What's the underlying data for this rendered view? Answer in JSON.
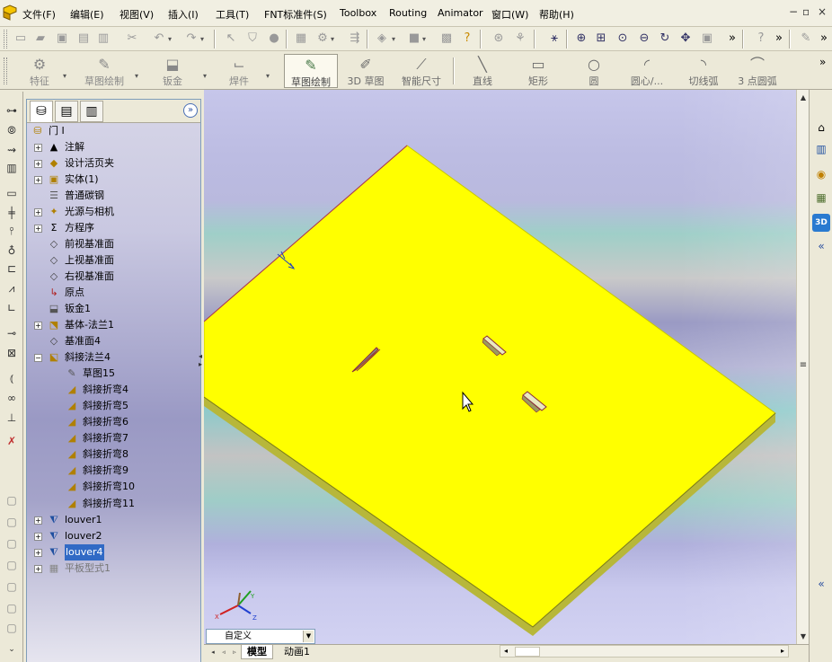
{
  "menu": {
    "items": [
      "文件(F)",
      "编辑(E)",
      "视图(V)",
      "插入(I)",
      "工具(T)",
      "FNT标准件(S)",
      "Toolbox",
      "Routing",
      "Animator",
      "窗口(W)",
      "帮助(H)"
    ]
  },
  "window_controls": {
    "minimize": "−",
    "restore": "▫",
    "close": "×"
  },
  "command_manager": {
    "items": [
      {
        "label": "特征",
        "icon": "feature-icon"
      },
      {
        "label": "草图绘制",
        "icon": "sketch-pencil-icon"
      },
      {
        "label": "钣金",
        "icon": "sheet-metal-icon"
      },
      {
        "label": "焊件",
        "icon": "weldment-icon"
      },
      {
        "label": "草图绘制",
        "icon": "sketch-icon"
      },
      {
        "label": "3D 草图",
        "icon": "3d-sketch-icon"
      },
      {
        "label": "智能尺寸",
        "icon": "smart-dimension-icon"
      },
      {
        "label": "直线",
        "icon": "line-icon"
      },
      {
        "label": "矩形",
        "icon": "rectangle-icon"
      },
      {
        "label": "圆",
        "icon": "circle-icon"
      },
      {
        "label": "圆心/...",
        "icon": "center-arc-icon"
      },
      {
        "label": "切线弧",
        "icon": "tangent-arc-icon"
      },
      {
        "label": "3 点圆弧",
        "icon": "three-point-arc-icon"
      }
    ],
    "more": "»"
  },
  "feature_tree": {
    "root": "门 I",
    "items": [
      {
        "label": "注解",
        "icon": "annotation-icon"
      },
      {
        "label": "设计活页夹",
        "icon": "design-binder-icon"
      },
      {
        "label": "实体(1)",
        "icon": "solid-bodies-icon"
      },
      {
        "label": "普通碳钢",
        "icon": "material-icon"
      },
      {
        "label": "光源与相机",
        "icon": "lights-camera-icon"
      },
      {
        "label": "方程序",
        "icon": "equations-icon"
      },
      {
        "label": "前视基准面",
        "icon": "plane-icon"
      },
      {
        "label": "上视基准面",
        "icon": "plane-icon"
      },
      {
        "label": "右视基准面",
        "icon": "plane-icon"
      },
      {
        "label": "原点",
        "icon": "origin-icon"
      },
      {
        "label": "钣金1",
        "icon": "sheet-metal-feature-icon"
      },
      {
        "label": "基体-法兰1",
        "icon": "base-flange-icon"
      },
      {
        "label": "基准面4",
        "icon": "plane-icon"
      },
      {
        "label": "斜接法兰4",
        "icon": "miter-flange-icon"
      },
      {
        "label": "草图15",
        "icon": "sketch-icon"
      },
      {
        "label": "斜接折弯4",
        "icon": "miter-bend-icon"
      },
      {
        "label": "斜接折弯5",
        "icon": "miter-bend-icon"
      },
      {
        "label": "斜接折弯6",
        "icon": "miter-bend-icon"
      },
      {
        "label": "斜接折弯7",
        "icon": "miter-bend-icon"
      },
      {
        "label": "斜接折弯8",
        "icon": "miter-bend-icon"
      },
      {
        "label": "斜接折弯9",
        "icon": "miter-bend-icon"
      },
      {
        "label": "斜接折弯10",
        "icon": "miter-bend-icon"
      },
      {
        "label": "斜接折弯11",
        "icon": "miter-bend-icon"
      },
      {
        "label": "louver1",
        "icon": "forming-tool-icon"
      },
      {
        "label": "louver2",
        "icon": "forming-tool-icon"
      },
      {
        "label": "louver4",
        "icon": "forming-tool-icon"
      },
      {
        "label": "平板型式1",
        "icon": "flat-pattern-icon"
      }
    ]
  },
  "view": {
    "orientation": "自定义",
    "tabs": [
      "模型",
      "动画1"
    ]
  },
  "colors": {
    "part": "#ffff00",
    "part_edge": "#c8c800",
    "part_side": "#b5b51a",
    "selection_highlight": "#316ac5"
  }
}
